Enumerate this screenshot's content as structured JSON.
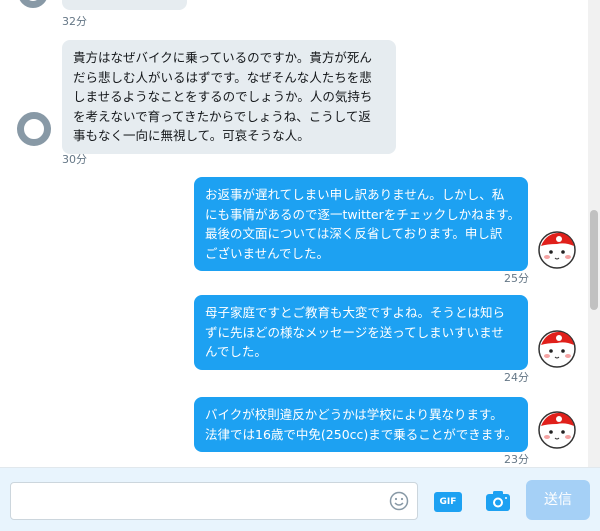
{
  "messages": {
    "first": {
      "time": "32分"
    },
    "received": {
      "lines": [
        "貴方はなぜバイクに乗っているのですか。貴方が死ん",
        "だら悲しむ人がいるはずです。なぜそんな人たちを悲",
        "しませるようなことをするのでしょうか。人の気持ち",
        "を考えないで育ってきたからでしょうね、こうして返",
        "事もなく一向に無視して。可哀そうな人。"
      ],
      "time": "30分"
    },
    "sent": [
      {
        "lines": [
          "お返事が遅れてしまい申し訳ありません。しかし、私",
          "にも事情があるので逐一twitterをチェックしかねます。",
          "最後の文面については深く反省しております。申し訳",
          "ございませんでした。"
        ],
        "time": "25分"
      },
      {
        "lines": [
          "母子家庭ですとご教育も大変ですよね。そうとは知ら",
          "ずに先ほどの様なメッセージを送ってしまいすいませ",
          "んでした。"
        ],
        "time": "24分"
      },
      {
        "lines": [
          "バイクが校則違反かどうかは学校により異なります。",
          "法律では16歳で中免(250cc)まで乗ることができます。"
        ],
        "time": "23分"
      }
    ]
  },
  "composer": {
    "placeholder": "",
    "gif_label": "GIF",
    "send_label": "送信"
  },
  "icons": {
    "emoji": "smiley-icon",
    "camera": "camera-icon"
  },
  "colors": {
    "accent": "#1da1f2",
    "bubble_in": "#e6ecf0",
    "send_disabled": "#a5d0f6"
  }
}
